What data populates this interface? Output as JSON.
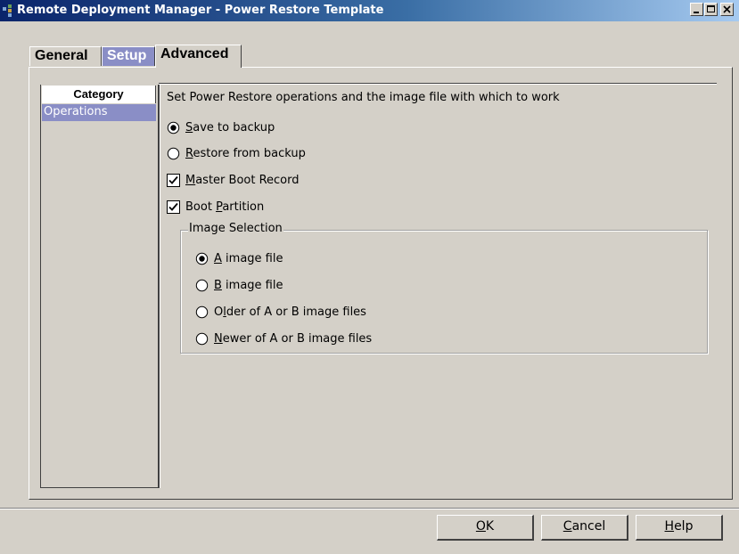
{
  "window": {
    "title": "Remote Deployment Manager - Power Restore Template",
    "controls": {
      "minimize": "minimize-icon",
      "maximize": "maximize-icon",
      "close": "close-icon"
    }
  },
  "tabs": [
    {
      "label": "General",
      "active": false
    },
    {
      "label": "Setup",
      "active": true
    },
    {
      "label": "Advanced",
      "active": false
    }
  ],
  "category": {
    "header": "Category",
    "items": [
      {
        "label": "Operations",
        "selected": true
      }
    ]
  },
  "operations": {
    "description": "Set Power Restore operations and the image file with which to work",
    "save_to_backup": {
      "mnemonic": "S",
      "rest": "ave to backup",
      "selected": true
    },
    "restore_from_backup": {
      "mnemonic": "R",
      "rest": "estore from backup",
      "selected": false
    },
    "master_boot_record": {
      "mnemonic": "M",
      "rest": "aster Boot Record",
      "checked": true
    },
    "boot_partition": {
      "pre": "Boot ",
      "mnemonic": "P",
      "rest": "artition",
      "checked": true
    }
  },
  "image_selection": {
    "label": "Image Selection",
    "options": [
      {
        "pre": "",
        "mnemonic": "A",
        "rest": " image file",
        "selected": true
      },
      {
        "pre": "",
        "mnemonic": "B",
        "rest": " image file",
        "selected": false
      },
      {
        "pre": "O",
        "mnemonic": "l",
        "rest": "der of A or B image files",
        "selected": false
      },
      {
        "pre": "",
        "mnemonic": "N",
        "rest": "ewer of A or B image files",
        "selected": false
      }
    ]
  },
  "buttons": {
    "ok": {
      "mnemonic": "O",
      "rest": "K"
    },
    "cancel": {
      "mnemonic": "C",
      "rest": "ancel"
    },
    "help": {
      "mnemonic": "H",
      "rest": "elp"
    }
  },
  "colors": {
    "window_bg": "#d4d0c8",
    "selection": "#8a8ec6",
    "titlebar_start": "#0a246a",
    "titlebar_end": "#a6caf0"
  }
}
